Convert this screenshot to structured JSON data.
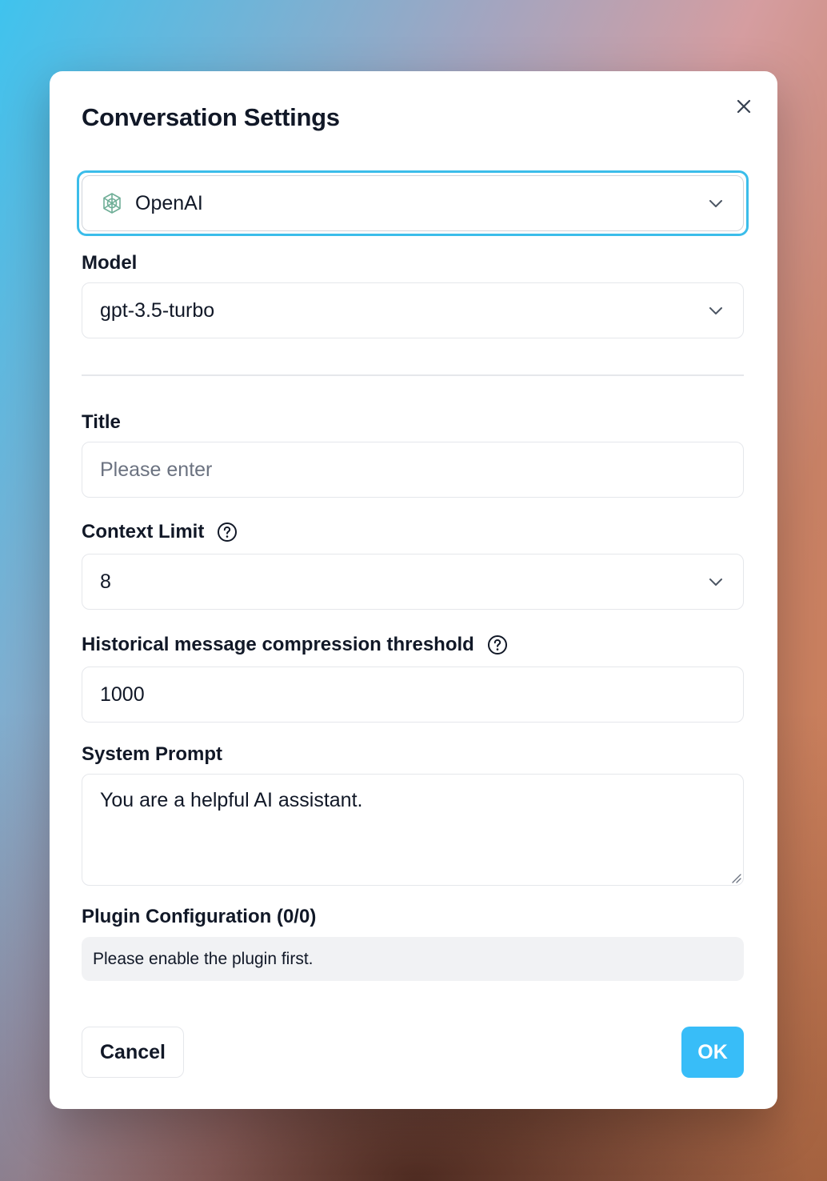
{
  "dialog": {
    "title": "Conversation Settings"
  },
  "provider": {
    "selected": "OpenAI",
    "icon": "openai-logo-icon"
  },
  "model": {
    "label": "Model",
    "selected": "gpt-3.5-turbo"
  },
  "title_field": {
    "label": "Title",
    "placeholder": "Please enter",
    "value": ""
  },
  "context_limit": {
    "label": "Context Limit",
    "selected": "8"
  },
  "compression": {
    "label": "Historical message compression threshold",
    "value": "1000"
  },
  "system_prompt": {
    "label": "System Prompt",
    "value": "You are a helpful AI assistant."
  },
  "plugins": {
    "label": "Plugin Configuration (0/0)",
    "note": "Please enable the plugin first."
  },
  "actions": {
    "cancel_label": "Cancel",
    "ok_label": "OK"
  },
  "colors": {
    "accent": "#38bdf8",
    "focus_ring": "#3bbdea",
    "text": "#111827"
  }
}
